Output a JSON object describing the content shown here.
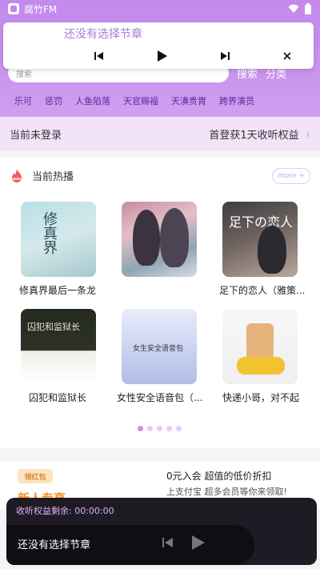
{
  "status_bar": {
    "app_name": "腐竹FM"
  },
  "top_player": {
    "title": "还没有选择节章"
  },
  "search": {
    "placeholder": "搜索",
    "search_label": "搜索",
    "category_label": "分类"
  },
  "tags": [
    "乐可",
    "惩罚",
    "人鱼陷落",
    "天官赐福",
    "天潢贵胄",
    "跨界演员"
  ],
  "login_bar": {
    "status": "当前未登录",
    "promo": "首登获1天收听权益"
  },
  "hot": {
    "title": "当前热播",
    "more_label": "more +",
    "items": [
      {
        "title": "修真界最后一条龙",
        "cover_text": "修真界"
      },
      {
        "title": "",
        "cover_text": ""
      },
      {
        "title": "足下的恋人（雅策...",
        "cover_text": "足下の恋人"
      },
      {
        "title": "囚犯和监狱长",
        "cover_text": "囚犯和监狱长"
      },
      {
        "title": "女性安全语音包（...",
        "cover_text": "女生安全语音包"
      },
      {
        "title": "快递小哥，对不起",
        "cover_text": ""
      }
    ],
    "page_count": 5,
    "active_page": 1
  },
  "promo": {
    "badge": "领红包",
    "left_title": "新人专享",
    "right_title": "0元入会 超值的低价折扣",
    "right_sub": "上支付宝 超多会员等你来领取!"
  },
  "bottom_player": {
    "remaining": "收听权益剩余: 00:00:00",
    "title": "还没有选择节章"
  },
  "colors": {
    "header": "#c389ec",
    "accent": "#c58fe8",
    "login_bg": "#f3e3f9",
    "player_bg": "#1e1b24"
  }
}
